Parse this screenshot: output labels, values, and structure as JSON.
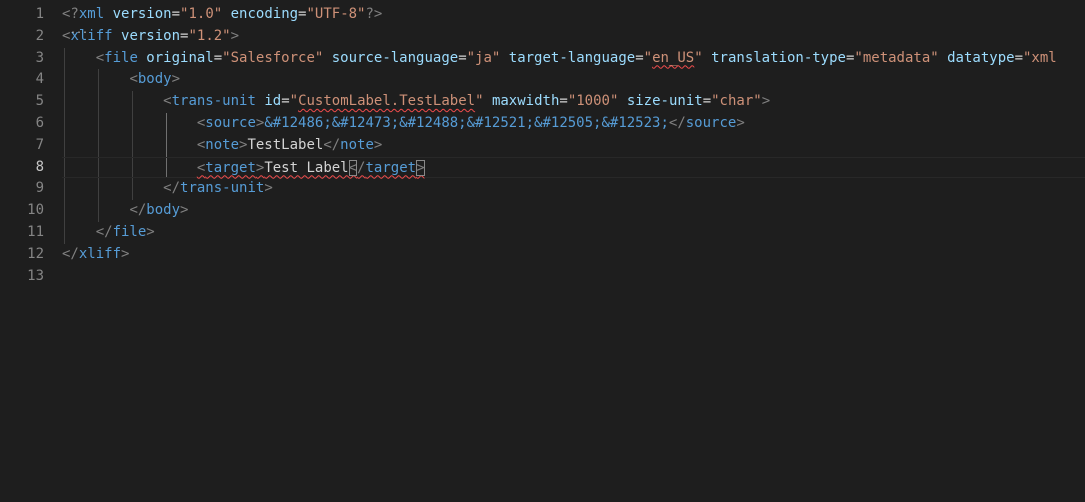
{
  "gutter": {
    "lines": [
      "1",
      "2",
      "3",
      "4",
      "5",
      "6",
      "7",
      "8",
      "9",
      "10",
      "11",
      "12",
      "13"
    ],
    "active_line": "8"
  },
  "code": {
    "l1": {
      "open": "<?",
      "name": "xml",
      "a1": " version",
      "eq1": "=",
      "v1": "\"1.0\"",
      "a2": " encoding",
      "eq2": "=",
      "v2": "\"UTF-8\"",
      "close": "?>"
    },
    "l2": {
      "open": "<",
      "name": "xliff",
      "a1": " version",
      "eq1": "=",
      "v1": "\"1.2\"",
      "close": ">"
    },
    "l3": {
      "open": "<",
      "name": "file",
      "a1": " original",
      "v1": "\"Salesforce\"",
      "a2": " source-language",
      "v2": "\"ja\"",
      "a3": " target-language",
      "v3_q1": "\"",
      "v3": "en_US",
      "v3_q2": "\"",
      "a4": " translation-type",
      "v4": "\"metadata\"",
      "a5": " datatype",
      "v5": "\"xml",
      "eq": "="
    },
    "l4": {
      "open": "<",
      "name": "body",
      "close": ">"
    },
    "l5": {
      "open": "<",
      "name": "trans-unit",
      "a1": " id",
      "eq": "=",
      "v1_q1": "\"",
      "v1": "CustomLabel.TestLabel",
      "v1_q2": "\"",
      "a2": " maxwidth",
      "v2": "\"1000\"",
      "a3": " size-unit",
      "v3": "\"char\"",
      "close": ">"
    },
    "l6": {
      "open": "<",
      "name": "source",
      "close": ">",
      "content": "&#12486;&#12473;&#12488;&#12521;&#12505;&#12523;",
      "end_open": "</",
      "end_name": "source",
      "end_close": ">"
    },
    "l7": {
      "open": "<",
      "name": "note",
      "close": ">",
      "content": "TestLabel",
      "end_open": "</",
      "end_name": "note",
      "end_close": ">"
    },
    "l8": {
      "open": "<",
      "name": "target",
      "close": ">",
      "content": "Test Label",
      "end_lt": "<",
      "end_slash": "/",
      "end_name": "target",
      "end_close": ">"
    },
    "l9": {
      "open": "</",
      "name": "trans-unit",
      "close": ">"
    },
    "l10": {
      "open": "</",
      "name": "body",
      "close": ">"
    },
    "l11": {
      "open": "</",
      "name": "file",
      "close": ">"
    },
    "l12": {
      "open": "</",
      "name": "xliff",
      "close": ">"
    },
    "fold_hint": "..."
  },
  "colors": {
    "background": "#1e1e1e",
    "tag": "#569cd6",
    "attribute": "#9cdcfe",
    "string": "#ce9178",
    "error_squiggle": "#f14c4c"
  }
}
